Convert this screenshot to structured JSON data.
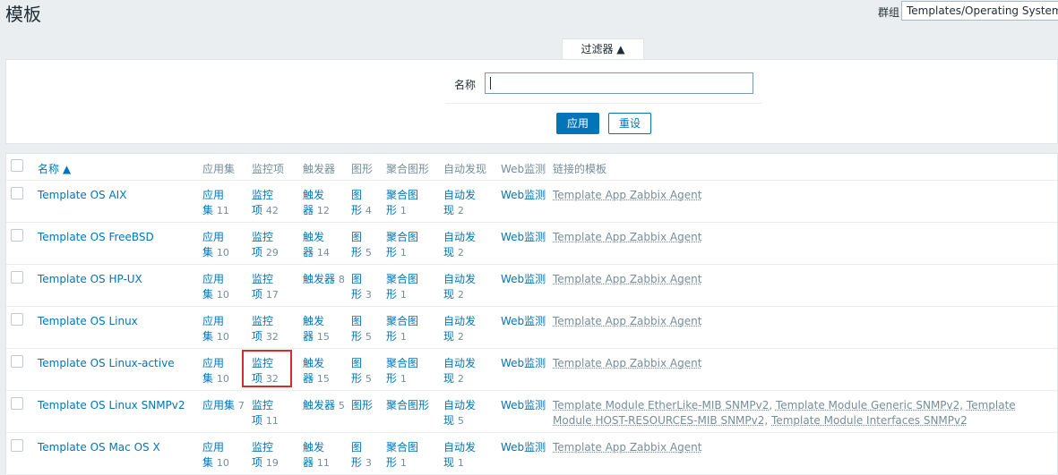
{
  "header": {
    "title": "模板",
    "group_label": "群组",
    "group_value": "Templates/Operating Systems"
  },
  "filter": {
    "tab_label": "过滤器 ▲",
    "name_label": "名称",
    "name_value": "",
    "apply_label": "应用",
    "reset_label": "重设"
  },
  "table": {
    "headers": {
      "name": "名称 ▲",
      "applications": "应用集",
      "items": "监控项",
      "triggers": "触发器",
      "graphs": "图形",
      "screens": "聚合图形",
      "discovery": "自动发现",
      "web": "Web监测",
      "linked": "链接的模板"
    },
    "rows": [
      {
        "name": "Template OS AIX",
        "app_a": "应用",
        "app_b": "集",
        "app_n": "11",
        "item_a": "监控",
        "item_b": "项",
        "item_n": "42",
        "trig_a": "触发",
        "trig_b": "器",
        "trig_n": "12",
        "graph_a": "图",
        "graph_b": "形",
        "graph_n": "4",
        "scr_a": "聚合图",
        "scr_b": "形",
        "scr_n": "1",
        "disc_a": "自动发",
        "disc_b": "现",
        "disc_n": "2",
        "web": "Web监测",
        "linked": "Template App Zabbix Agent"
      },
      {
        "name": "Template OS FreeBSD",
        "app_a": "应用",
        "app_b": "集",
        "app_n": "10",
        "item_a": "监控",
        "item_b": "项",
        "item_n": "29",
        "trig_a": "触发",
        "trig_b": "器",
        "trig_n": "14",
        "graph_a": "图",
        "graph_b": "形",
        "graph_n": "5",
        "scr_a": "聚合图",
        "scr_b": "形",
        "scr_n": "1",
        "disc_a": "自动发",
        "disc_b": "现",
        "disc_n": "2",
        "web": "Web监测",
        "linked": "Template App Zabbix Agent"
      },
      {
        "name": "Template OS HP-UX",
        "app_a": "应用",
        "app_b": "集",
        "app_n": "10",
        "item_a": "监控",
        "item_b": "项",
        "item_n": "17",
        "trig_a": "触发器",
        "trig_n": "8",
        "graph_a": "图",
        "graph_b": "形",
        "graph_n": "3",
        "scr_a": "聚合图",
        "scr_b": "形",
        "scr_n": "1",
        "disc_a": "自动发",
        "disc_b": "现",
        "disc_n": "2",
        "web": "Web监测",
        "linked": "Template App Zabbix Agent"
      },
      {
        "name": "Template OS Linux",
        "app_a": "应用",
        "app_b": "集",
        "app_n": "10",
        "item_a": "监控",
        "item_b": "项",
        "item_n": "32",
        "trig_a": "触发",
        "trig_b": "器",
        "trig_n": "15",
        "graph_a": "图",
        "graph_b": "形",
        "graph_n": "5",
        "scr_a": "聚合图",
        "scr_b": "形",
        "scr_n": "1",
        "disc_a": "自动发",
        "disc_b": "现",
        "disc_n": "2",
        "web": "Web监测",
        "linked": "Template App Zabbix Agent"
      },
      {
        "name": "Template OS Linux-active",
        "app_a": "应用",
        "app_b": "集",
        "app_n": "10",
        "item_a": "监控",
        "item_b": "项",
        "item_n": "32",
        "trig_a": "触发",
        "trig_b": "器",
        "trig_n": "15",
        "graph_a": "图",
        "graph_b": "形",
        "graph_n": "5",
        "scr_a": "聚合图",
        "scr_b": "形",
        "scr_n": "1",
        "disc_a": "自动发",
        "disc_b": "现",
        "disc_n": "2",
        "web": "Web监测",
        "linked": "Template App Zabbix Agent"
      },
      {
        "name": "Template OS Linux SNMPv2",
        "app_a": "应用集",
        "app_n": "7",
        "item_a": "监控",
        "item_b": "项",
        "item_n": "11",
        "trig_a": "触发器",
        "trig_n": "5",
        "graph_a": "图形",
        "scr_a": "聚合图形",
        "disc_a": "自动发",
        "disc_b": "现",
        "disc_n": "5",
        "web": "Web监测",
        "linked_list": [
          "Template Module EtherLike-MIB SNMPv2",
          "Template Module Generic SNMPv2",
          "Template Module HOST-RESOURCES-MIB SNMPv2",
          "Template Module Interfaces SNMPv2"
        ]
      },
      {
        "name": "Template OS Mac OS X",
        "app_a": "应用",
        "app_b": "集",
        "app_n": "10",
        "item_a": "监控",
        "item_b": "项",
        "item_n": "19",
        "trig_a": "触发",
        "trig_b": "器",
        "trig_n": "11",
        "graph_a": "图",
        "graph_b": "形",
        "graph_n": "3",
        "scr_a": "聚合图",
        "scr_b": "形",
        "scr_n": "1",
        "disc_a": "自动发",
        "disc_b": "现",
        "disc_n": "1",
        "web": "Web监测",
        "linked": "Template App Zabbix Agent"
      }
    ]
  }
}
